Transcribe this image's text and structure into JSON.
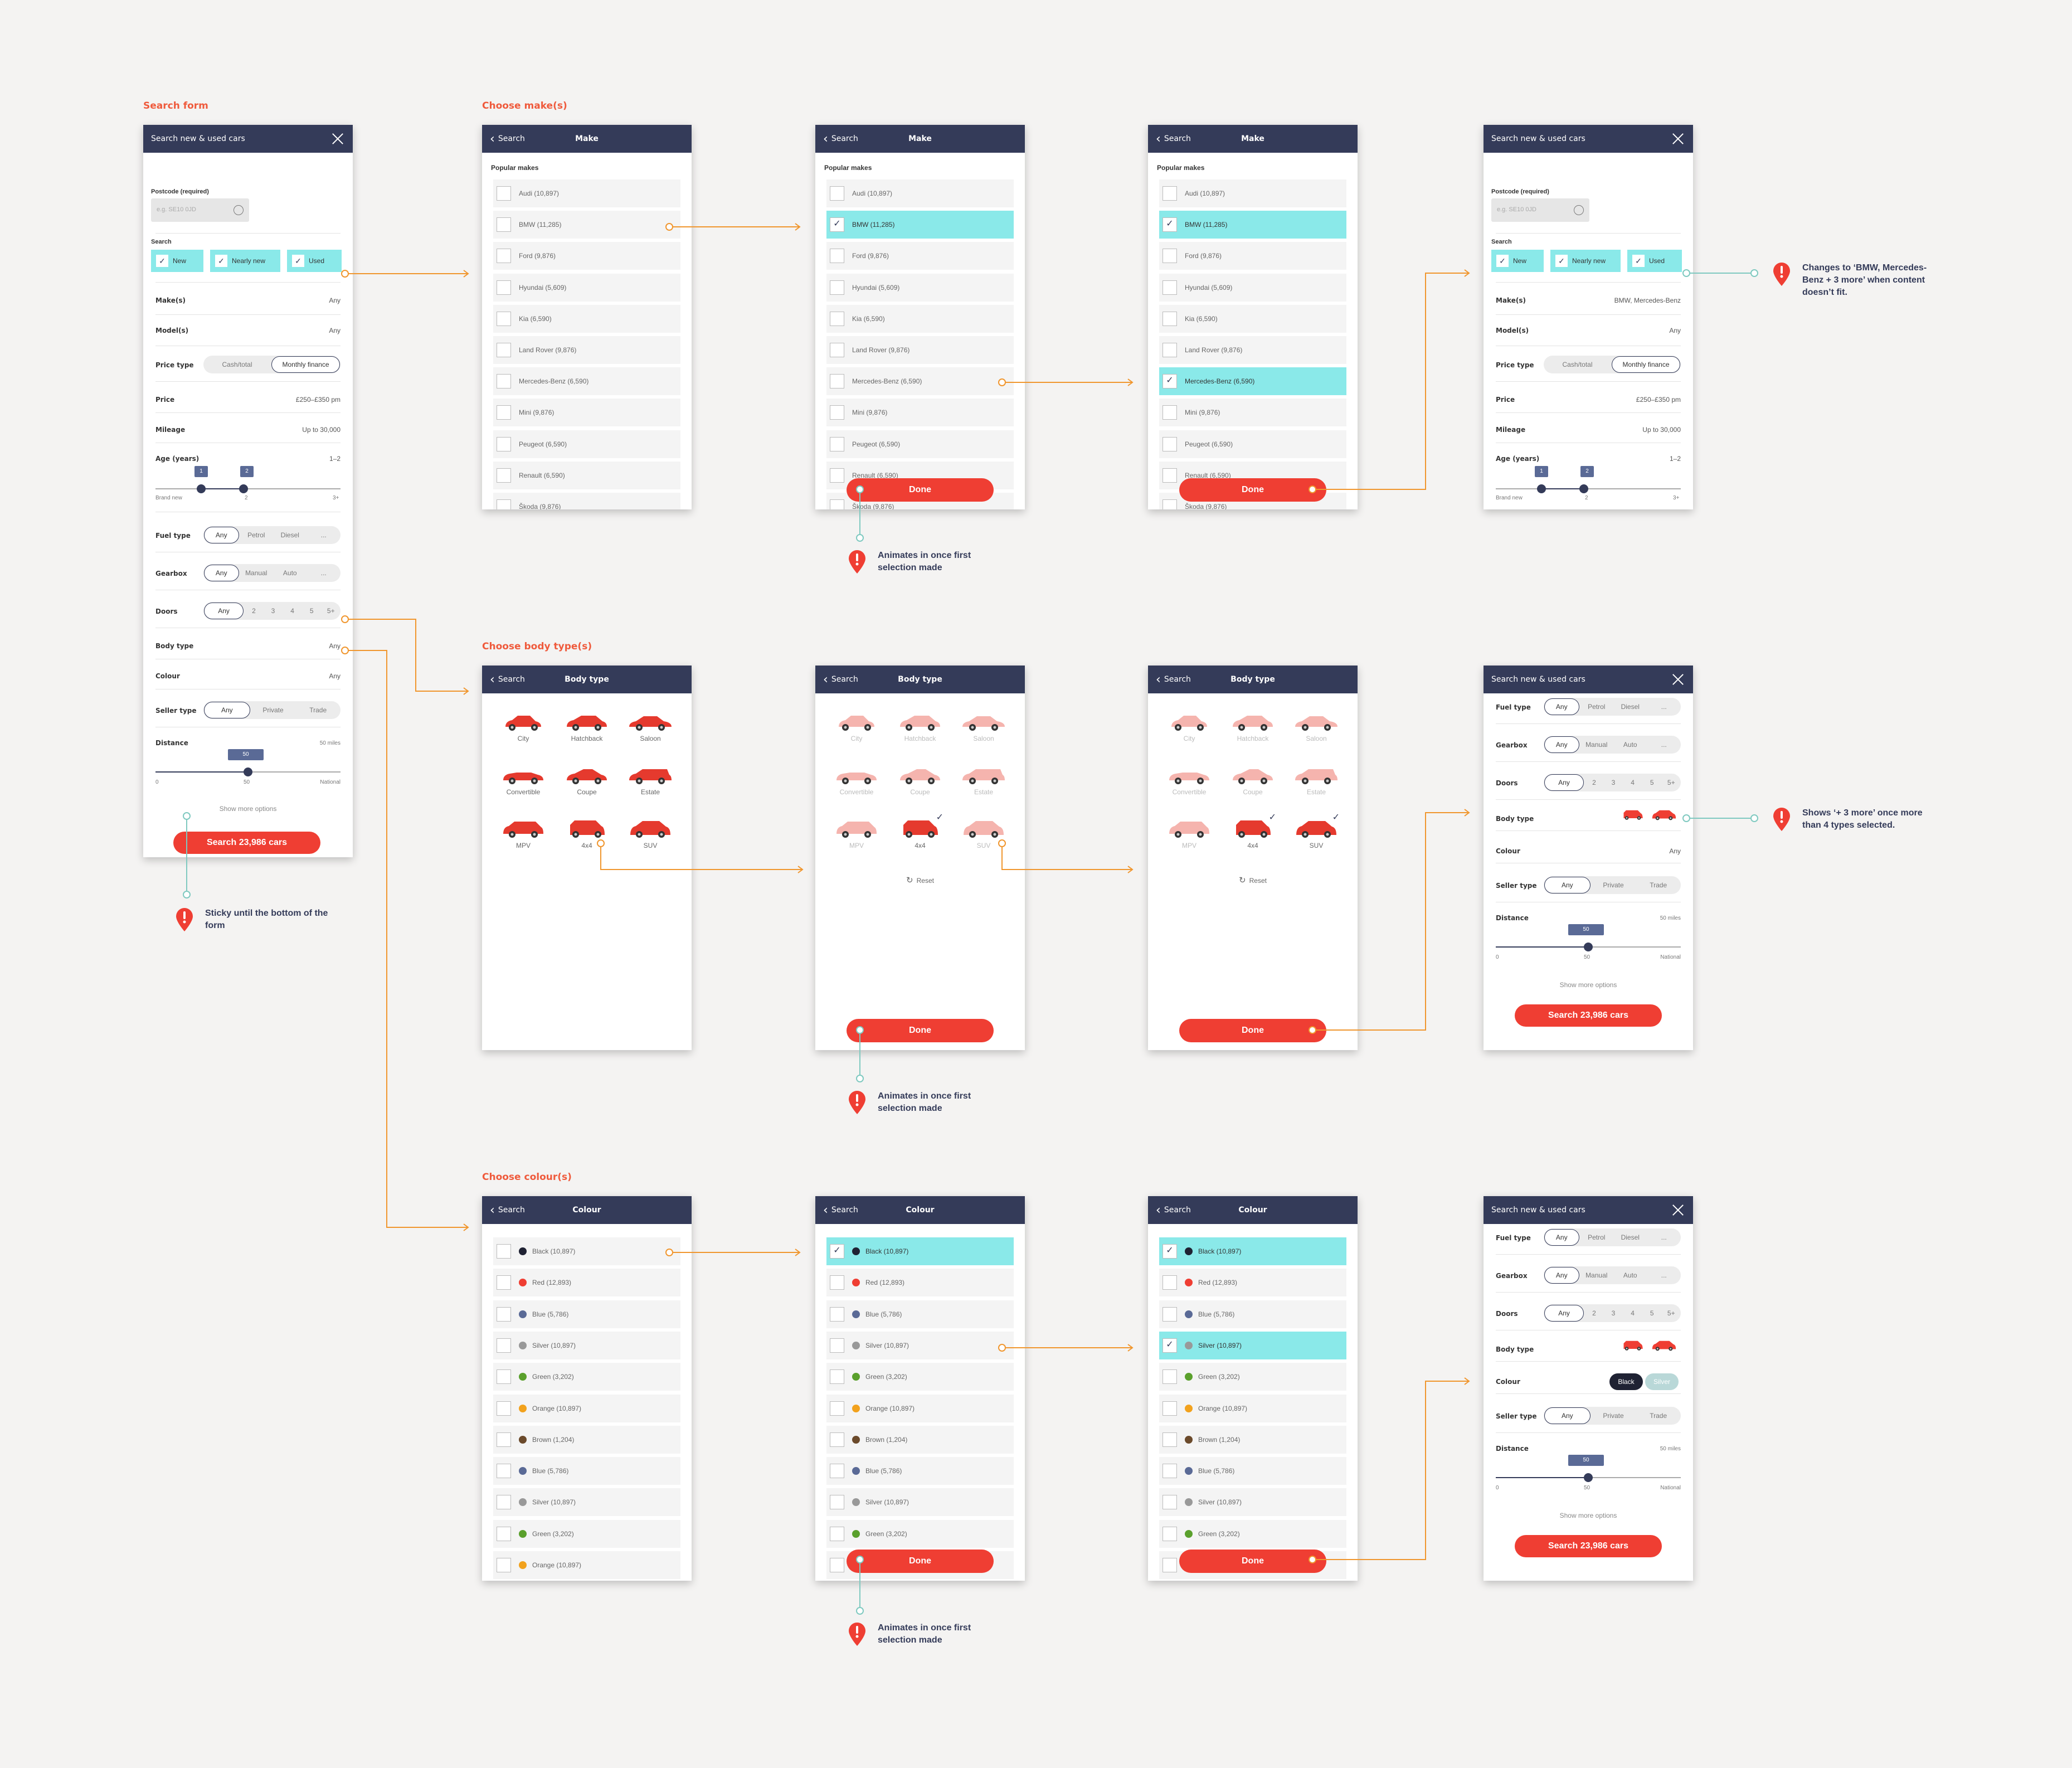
{
  "section_labels": {
    "search_form": "Search form",
    "choose_makes": "Choose make(s)",
    "choose_body": "Choose body type(s)",
    "choose_colour": "Choose colour(s)"
  },
  "header": {
    "form_title": "Search new & used cars",
    "back_label": "Search",
    "make_title": "Make",
    "body_title": "Body type",
    "colour_title": "Colour"
  },
  "form": {
    "postcode_label": "Postcode (required)",
    "postcode_placeholder": "e.g. SE10 0JD",
    "search_label": "Search",
    "chips": [
      "New",
      "Nearly new",
      "Used"
    ],
    "makes_label": "Make(s)",
    "makes_value_initial": "Any",
    "makes_value_updated": "BMW, Mercedes-Benz",
    "models_label": "Model(s)",
    "models_value": "Any",
    "price_type_label": "Price type",
    "price_type_options": [
      "Cash/total",
      "Monthly finance"
    ],
    "price_label": "Price",
    "price_value": "£250–£350 pm",
    "mileage_label": "Mileage",
    "mileage_value": "Up to 30,000",
    "age_label": "Age (years)",
    "age_value": "1–2",
    "age_tag_low": "1",
    "age_tag_high": "2",
    "age_min": "Brand new",
    "age_mid": "2",
    "age_max": "3+",
    "fuel_label": "Fuel type",
    "fuel_options": [
      "Any",
      "Petrol",
      "Diesel",
      "..."
    ],
    "gearbox_label": "Gearbox",
    "gearbox_options": [
      "Any",
      "Manual",
      "Auto",
      "..."
    ],
    "doors_label": "Doors",
    "doors_options": [
      "Any",
      "2",
      "3",
      "4",
      "5",
      "5+"
    ],
    "body_label": "Body type",
    "body_value": "Any",
    "colour_label": "Colour",
    "colour_value": "Any",
    "colour_sel_black": "Black",
    "colour_sel_silver": "Silver",
    "seller_label": "Seller type",
    "seller_options": [
      "Any",
      "Private",
      "Trade"
    ],
    "distance_label": "Distance",
    "distance_value": "50 miles",
    "distance_tag": "50",
    "distance_min": "0",
    "distance_mid": "50",
    "distance_max": "National",
    "show_more": "Show more options",
    "search_button": "Search 23,986 cars"
  },
  "makes": {
    "heading": "Popular makes",
    "items": [
      "Audi (10,897)",
      "BMW (11,285)",
      "Ford (9,876)",
      "Hyundai (5,609)",
      "Kia (6,590)",
      "Land Rover (9,876)",
      "Mercedes-Benz (6,590)",
      "Mini (9,876)",
      "Peugeot (6,590)",
      "Renault (6,590)",
      "Škoda (9,876)"
    ],
    "done": "Done"
  },
  "body_types": {
    "items": [
      "City",
      "Hatchback",
      "Saloon",
      "Convertible",
      "Coupe",
      "Estate",
      "MPV",
      "4x4",
      "SUV"
    ],
    "reset": "Reset",
    "done": "Done",
    "car_color": "#e53a2e",
    "car_faded": "#f5b4ae"
  },
  "colours": {
    "items": [
      {
        "label": "Black (10,897)",
        "color": "#1f2233"
      },
      {
        "label": "Red (12,893)",
        "color": "#ef3e33"
      },
      {
        "label": "Blue (5,786)",
        "color": "#5a6a96"
      },
      {
        "label": "Silver (10,897)",
        "color": "#999999"
      },
      {
        "label": "Green (3,202)",
        "color": "#5aa02c"
      },
      {
        "label": "Orange (10,897)",
        "color": "#f2a21d"
      },
      {
        "label": "Brown (1,204)",
        "color": "#6b4a2b"
      },
      {
        "label": "Blue (5,786)",
        "color": "#5a6a96"
      },
      {
        "label": "Silver (10,897)",
        "color": "#999999"
      },
      {
        "label": "Green (3,202)",
        "color": "#5aa02c"
      },
      {
        "label": "Orange (10,897)",
        "color": "#f2a21d"
      }
    ],
    "done": "Done"
  },
  "notes": {
    "sticky": "Sticky until the bottom of the form",
    "animates": "Animates in once first selection made",
    "changes": "Changes to ‘BMW, Mercedes-Benz + 3 more’ when content doesn’t fit.",
    "shows_more": "Shows ‘+ 3 more’ once more than 4 types selected."
  },
  "colors": {
    "accent": "#ef3e33",
    "navy": "#343b59",
    "teal": "#8ae9e9",
    "wire_orange": "#f0962e",
    "wire_teal": "#7fc9c0"
  }
}
